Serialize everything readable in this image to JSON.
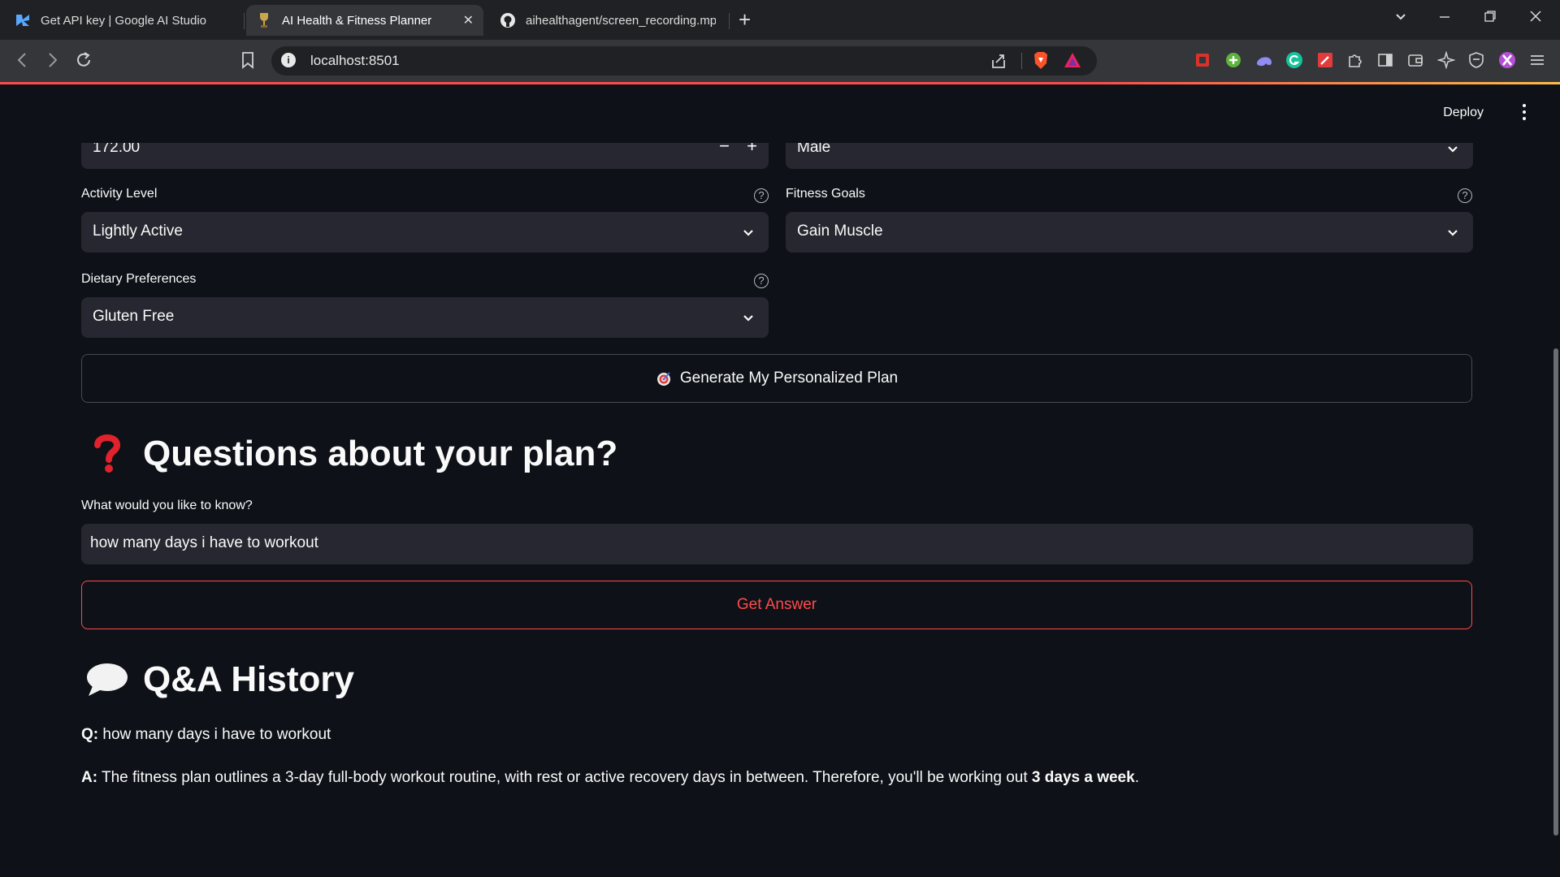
{
  "browser": {
    "tabs": [
      {
        "label": "Get API key | Google AI Studio",
        "icon": "google-ai-studio-icon"
      },
      {
        "label": "AI Health & Fitness Planner",
        "icon": "trophy-icon",
        "active": true
      },
      {
        "label": "aihealthagent/screen_recording.mp",
        "icon": "github-icon"
      }
    ],
    "url": "localhost:8501"
  },
  "app": {
    "deploy_label": "Deploy",
    "height_value": "172.00",
    "sex_value": "Male",
    "activity": {
      "label": "Activity Level",
      "value": "Lightly Active"
    },
    "goals": {
      "label": "Fitness Goals",
      "value": "Gain Muscle"
    },
    "dietary": {
      "label": "Dietary Preferences",
      "value": "Gluten Free"
    },
    "generate_button": "Generate My Personalized Plan",
    "questions_heading": "Questions about your plan?",
    "question_label": "What would you like to know?",
    "question_value": "how many days i have to workout",
    "get_answer_button": "Get Answer",
    "history_heading": "Q&A History",
    "history": {
      "q_prefix": "Q:",
      "q_text": "how many days i have to workout",
      "a_prefix": "A:",
      "a_text": "The fitness plan outlines a 3-day full-body workout routine, with rest or active recovery days in between. Therefore, you'll be working out",
      "a_bold": "3 days a week",
      "a_end": "."
    },
    "colors": {
      "background": "#0e1117",
      "input": "#262730",
      "accent": "#ff4b4b"
    }
  }
}
